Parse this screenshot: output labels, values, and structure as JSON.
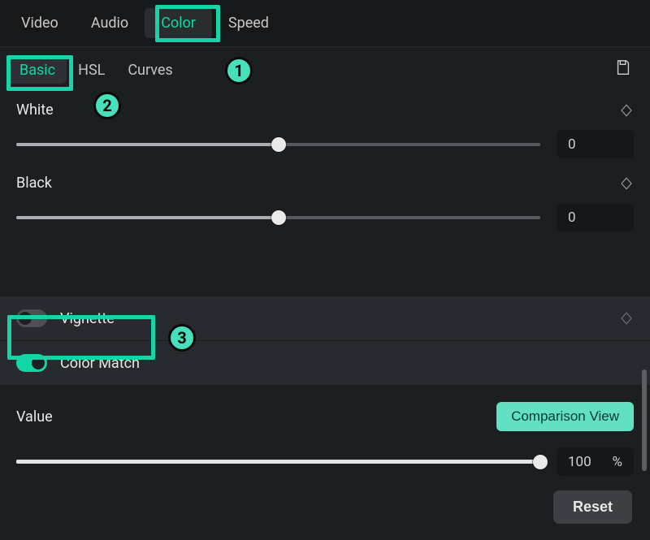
{
  "accent": "#13d6a6",
  "topTabs": {
    "items": [
      "Video",
      "Audio",
      "Color",
      "Speed"
    ],
    "activeIndex": 2
  },
  "subTabs": {
    "items": [
      "Basic",
      "HSL",
      "Curves"
    ],
    "activeIndex": 0
  },
  "sliders": {
    "white": {
      "label": "White",
      "value": "0",
      "fillPct": 50
    },
    "black": {
      "label": "Black",
      "value": "0",
      "fillPct": 50
    }
  },
  "toggles": {
    "vignette": {
      "label": "Vignette",
      "on": false
    },
    "colorMatch": {
      "label": "Color Match",
      "on": true
    }
  },
  "valueSection": {
    "label": "Value",
    "comparisonBtn": "Comparison View",
    "value": "100",
    "unit": "%",
    "fillPct": 100
  },
  "footer": {
    "reset": "Reset"
  },
  "callouts": {
    "c1": "1",
    "c2": "2",
    "c3": "3"
  }
}
